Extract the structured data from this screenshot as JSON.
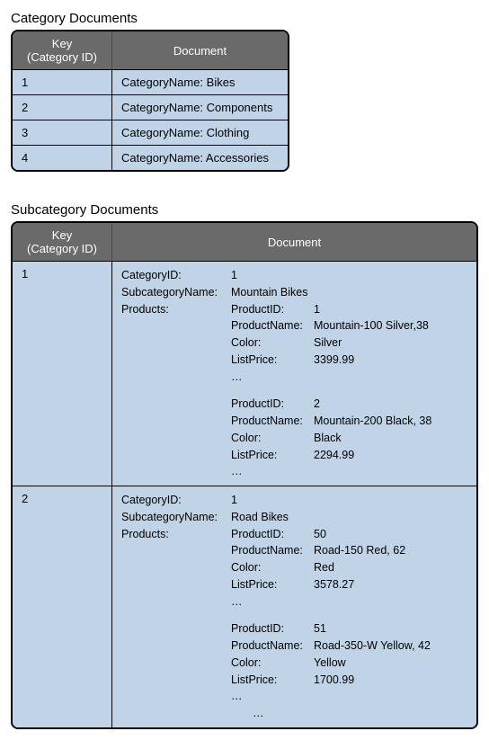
{
  "category": {
    "title": "Category Documents",
    "headers": {
      "key": "Key\n(Category ID)",
      "doc": "Document"
    },
    "rows": [
      {
        "key": "1",
        "doc": "CategoryName: Bikes"
      },
      {
        "key": "2",
        "doc": "CategoryName: Components"
      },
      {
        "key": "3",
        "doc": "CategoryName: Clothing"
      },
      {
        "key": "4",
        "doc": "CategoryName: Accessories"
      }
    ]
  },
  "subcategory": {
    "title": "Subcategory Documents",
    "headers": {
      "key": "Key\n(Category ID)",
      "doc": "Document"
    },
    "labels": {
      "categoryId": "CategoryID:",
      "subcategoryName": "SubcategoryName:",
      "products": "Products:",
      "productId": "ProductID:",
      "productName": "ProductName:",
      "color": "Color:",
      "listPrice": "ListPrice:",
      "ellipsis": "…"
    },
    "rows": [
      {
        "key": "1",
        "categoryId": "1",
        "subcategoryName": "Mountain Bikes",
        "products": [
          {
            "productId": "1",
            "productName": "Mountain-100 Silver,38",
            "color": "Silver",
            "listPrice": "3399.99"
          },
          {
            "productId": "2",
            "productName": "Mountain-200 Black, 38",
            "color": "Black",
            "listPrice": "2294.99"
          }
        ],
        "trailingEllipsis": false
      },
      {
        "key": "2",
        "categoryId": "1",
        "subcategoryName": "Road Bikes",
        "products": [
          {
            "productId": "50",
            "productName": "Road-150 Red, 62",
            "color": "Red",
            "listPrice": "3578.27"
          },
          {
            "productId": "51",
            "productName": "Road-350-W Yellow, 42",
            "color": "Yellow",
            "listPrice": "1700.99"
          }
        ],
        "trailingEllipsis": true
      }
    ]
  }
}
